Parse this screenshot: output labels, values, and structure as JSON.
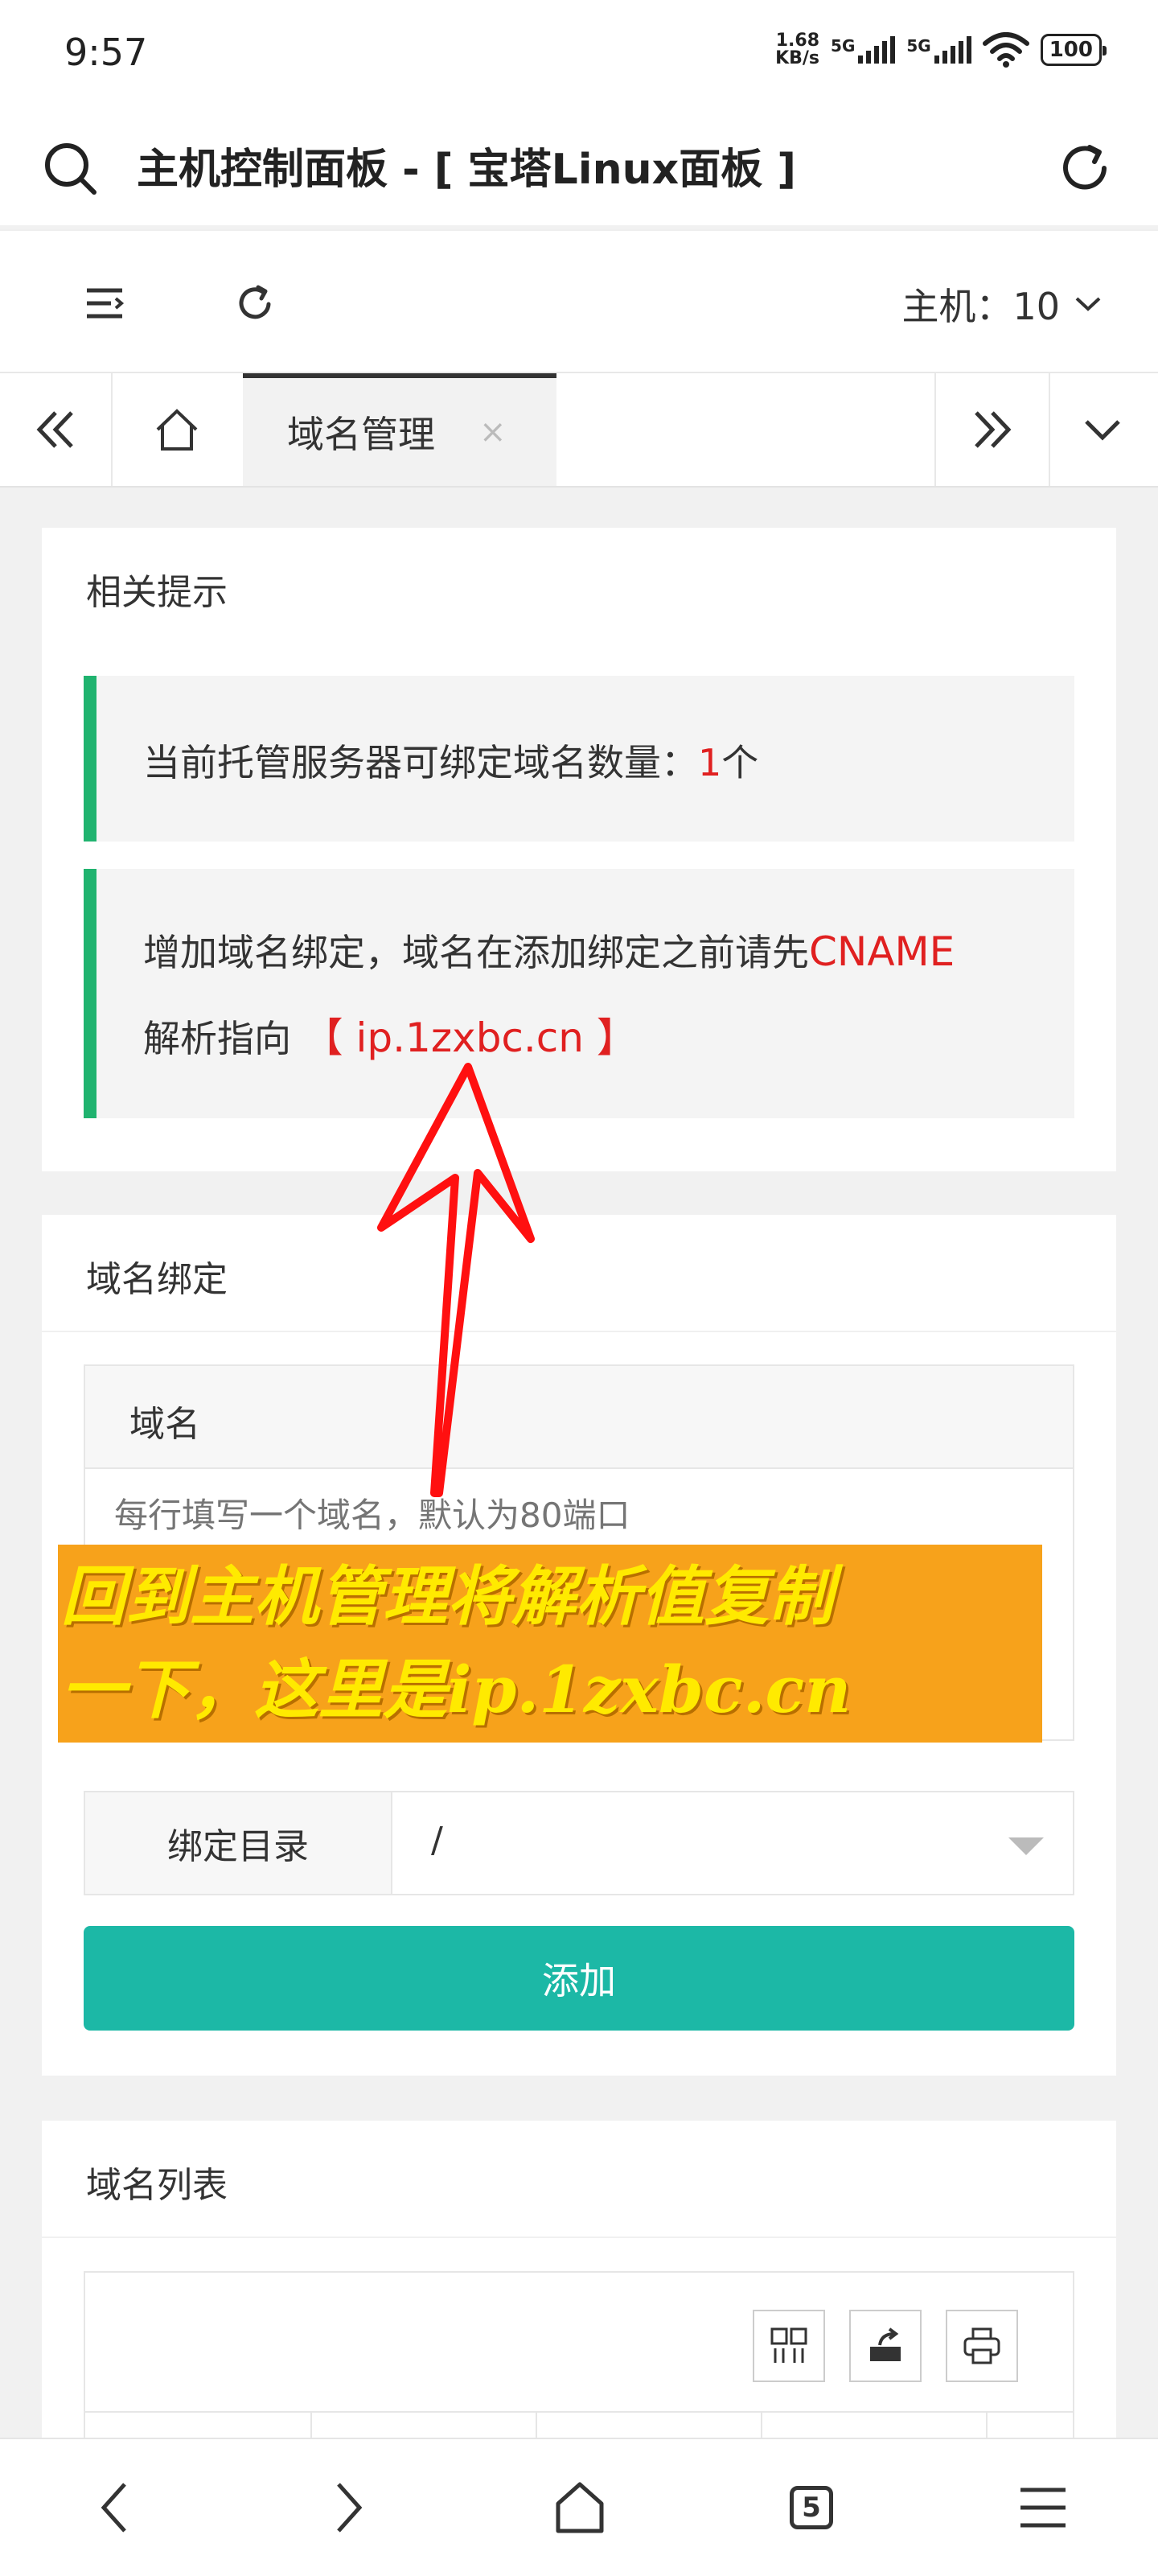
{
  "status_bar": {
    "time": "9:57",
    "net_speed_value": "1.68",
    "net_speed_unit": "KB/s",
    "signal1_label": "5G",
    "signal2_label": "5G",
    "battery": "100"
  },
  "app_bar": {
    "title": "主机控制面板 - [ 宝塔Linux面板 ]"
  },
  "toolbar": {
    "host_label": "主机：10"
  },
  "tabs": {
    "active_label": "域名管理",
    "close_glyph": "×"
  },
  "tips_card": {
    "title": "相关提示",
    "notice1_prefix": "当前托管服务器可绑定域名数量：",
    "notice1_count": "1",
    "notice1_suffix": "个",
    "notice2_line1_prefix": "增加域名绑定，域名在添加绑定之前请先",
    "notice2_cname": "CNAME",
    "notice2_line2_prefix": "解析指向",
    "notice2_target": "【 ip.1zxbc.cn 】"
  },
  "bind_card": {
    "title": "域名绑定",
    "domain_header": "域名",
    "domain_placeholder": "每行填写一个域名，默认为80端口",
    "dir_label": "绑定目录",
    "dir_value": "/",
    "add_button": "添加"
  },
  "list_card": {
    "title": "域名列表"
  },
  "overlay": {
    "line1": "回到主机管理将解析值复制",
    "line2": "一下，这里是ip.1zxbc.cn"
  },
  "nav_bar": {
    "tabs_count": "5"
  },
  "colors": {
    "accent_green": "#20b36f",
    "button_teal": "#1cb8a6",
    "highlight_red": "#e02020",
    "overlay_orange": "#f7a21b",
    "overlay_text": "#ffea00",
    "arrow_red": "#ff1010"
  }
}
